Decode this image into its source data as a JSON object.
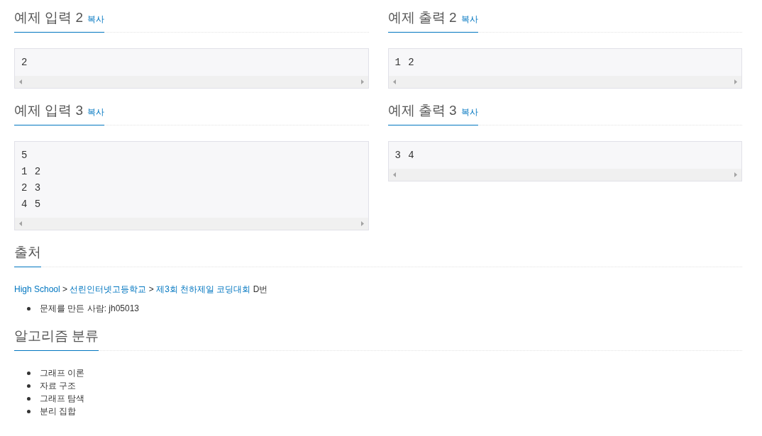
{
  "samples": [
    {
      "title": "예제 입력 2",
      "copy_label": "복사",
      "lines": [
        "2"
      ]
    },
    {
      "title": "예제 출력 2",
      "copy_label": "복사",
      "lines": [
        "1 2"
      ]
    },
    {
      "title": "예제 입력 3",
      "copy_label": "복사",
      "lines": [
        "5",
        "1 2",
        "2 3",
        "4 5"
      ]
    },
    {
      "title": "예제 출력 3",
      "copy_label": "복사",
      "lines": [
        "3 4"
      ]
    }
  ],
  "source": {
    "heading": "출처",
    "path": [
      {
        "kind": "link",
        "text": "High School"
      },
      {
        "kind": "separator",
        "text": ">"
      },
      {
        "kind": "link",
        "text": "선린인터넷고등학교"
      },
      {
        "kind": "separator",
        "text": ">"
      },
      {
        "kind": "link",
        "text": "제3회 천하제일 코딩대회"
      },
      {
        "kind": "text",
        "text": "D번"
      }
    ],
    "credits": [
      "문제를 만든 사람: jh05013"
    ]
  },
  "algorithm_tags": {
    "heading": "알고리즘 분류",
    "items": [
      "그래프 이론",
      "자료 구조",
      "그래프 탐색",
      "분리 집합"
    ]
  }
}
